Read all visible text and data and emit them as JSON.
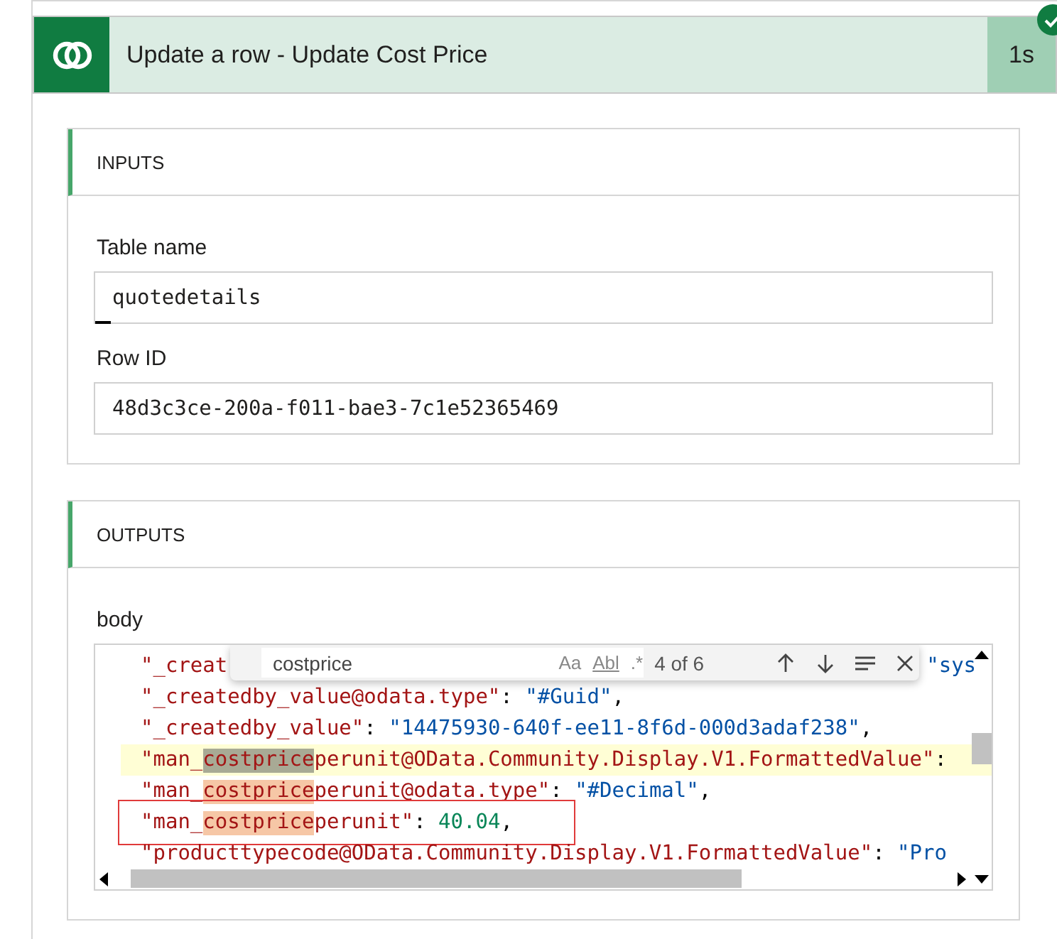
{
  "action": {
    "title": "Update a row - Update Cost Price",
    "duration": "1s",
    "succeeded": true
  },
  "inputs": {
    "heading": "INPUTS",
    "fields": [
      {
        "label": "Table name",
        "value": "quotedetails",
        "caret": true
      },
      {
        "label": "Row ID",
        "value": "48d3c3ce-200a-f011-bae3-7c1e52365469",
        "caret": false
      }
    ]
  },
  "outputs": {
    "heading": "OUTPUTS",
    "label": "body",
    "find": {
      "value": "costprice",
      "match_case": "Aa",
      "whole_word": "Abl",
      "regex": ".*",
      "count": "4 of 6"
    },
    "code_lines": [
      {
        "highlighted": false,
        "boxed": false,
        "tokens": [
          {
            "kind": "key",
            "text": "\"_creat"
          },
          {
            "kind": "far-str",
            "text": "\"sys"
          }
        ]
      },
      {
        "highlighted": false,
        "boxed": false,
        "tokens": [
          {
            "kind": "key",
            "text": "\"_createdby_value@odata.type\""
          },
          {
            "kind": "punct",
            "text": ": "
          },
          {
            "kind": "str",
            "text": "\"#Guid\""
          },
          {
            "kind": "punct",
            "text": ","
          }
        ]
      },
      {
        "highlighted": false,
        "boxed": false,
        "tokens": [
          {
            "kind": "key",
            "text": "\"_createdby_value\""
          },
          {
            "kind": "punct",
            "text": ": "
          },
          {
            "kind": "str",
            "text": "\"14475930-640f-ee11-8f6d-000d3adaf238\""
          },
          {
            "kind": "punct",
            "text": ","
          }
        ]
      },
      {
        "highlighted": true,
        "boxed": false,
        "tokens": [
          {
            "kind": "key",
            "text": "\"man_"
          },
          {
            "kind": "current-match",
            "text": "costprice"
          },
          {
            "kind": "key",
            "text": "perunit@OData.Community.Display.V1.FormattedValue\""
          },
          {
            "kind": "punct",
            "text": ":"
          }
        ]
      },
      {
        "highlighted": false,
        "boxed": false,
        "tokens": [
          {
            "kind": "key",
            "text": "\"man_"
          },
          {
            "kind": "match",
            "text": "costprice"
          },
          {
            "kind": "key",
            "text": "perunit@odata.type\""
          },
          {
            "kind": "punct",
            "text": ": "
          },
          {
            "kind": "str",
            "text": "\"#Decimal\""
          },
          {
            "kind": "punct",
            "text": ","
          }
        ]
      },
      {
        "highlighted": false,
        "boxed": true,
        "tokens": [
          {
            "kind": "key",
            "text": "\"man_"
          },
          {
            "kind": "match",
            "text": "costprice"
          },
          {
            "kind": "key",
            "text": "perunit\""
          },
          {
            "kind": "punct",
            "text": ": "
          },
          {
            "kind": "num",
            "text": "40.04"
          },
          {
            "kind": "punct",
            "text": ","
          }
        ]
      },
      {
        "highlighted": false,
        "boxed": false,
        "tokens": [
          {
            "kind": "key",
            "text": "\"producttypecode@OData.Community.Display.V1.FormattedValue\""
          },
          {
            "kind": "punct",
            "text": ": "
          },
          {
            "kind": "str",
            "text": "\"Pro"
          }
        ]
      }
    ]
  }
}
